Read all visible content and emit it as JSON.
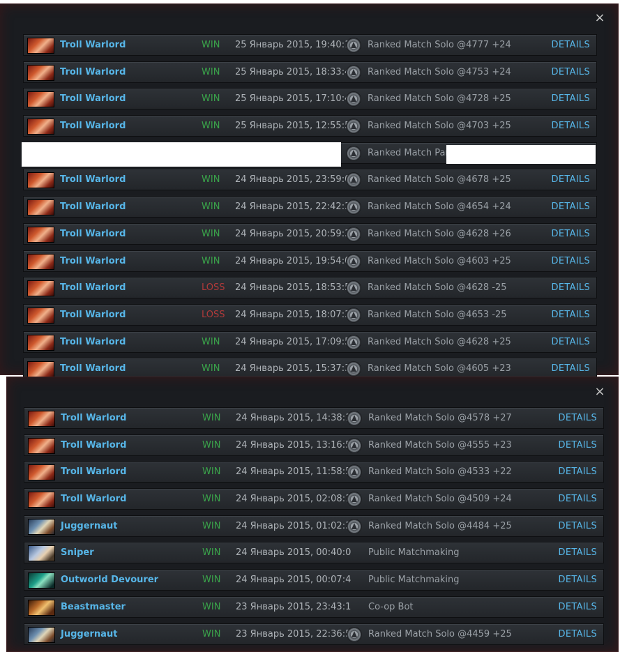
{
  "close_glyph": "×",
  "details_label": "DETAILS",
  "panel1": {
    "matches": [
      {
        "hero": "Troll Warlord",
        "hero_icon": "troll-warlord-portrait",
        "result": "WIN",
        "date": "25 Январь 2015, 19:40:1",
        "mode": "Ranked Match Solo @4777 +24",
        "mm_icon": true
      },
      {
        "hero": "Troll Warlord",
        "hero_icon": "troll-warlord-portrait",
        "result": "WIN",
        "date": "25 Январь 2015, 18:33:4",
        "mode": "Ranked Match Solo @4753 +24",
        "mm_icon": true
      },
      {
        "hero": "Troll Warlord",
        "hero_icon": "troll-warlord-portrait",
        "result": "WIN",
        "date": "25 Январь 2015, 17:10:4",
        "mode": "Ranked Match Solo @4728 +25",
        "mm_icon": true
      },
      {
        "hero": "Troll Warlord",
        "hero_icon": "troll-warlord-portrait",
        "result": "WIN",
        "date": "25 Январь 2015, 12:55:5",
        "mode": "Ranked Match Solo @4703 +25",
        "mm_icon": true
      },
      {
        "hero": "",
        "hero_icon": "",
        "result": "",
        "date": "",
        "mode": "Ranked Match Party",
        "mm_icon": true,
        "redacted": true
      },
      {
        "hero": "Troll Warlord",
        "hero_icon": "troll-warlord-portrait",
        "result": "WIN",
        "date": "24 Январь 2015, 23:59:0",
        "mode": "Ranked Match Solo @4678 +25",
        "mm_icon": true
      },
      {
        "hero": "Troll Warlord",
        "hero_icon": "troll-warlord-portrait",
        "result": "WIN",
        "date": "24 Январь 2015, 22:42:3",
        "mode": "Ranked Match Solo @4654 +24",
        "mm_icon": true
      },
      {
        "hero": "Troll Warlord",
        "hero_icon": "troll-warlord-portrait",
        "result": "WIN",
        "date": "24 Январь 2015, 20:59:3",
        "mode": "Ranked Match Solo @4628 +26",
        "mm_icon": true
      },
      {
        "hero": "Troll Warlord",
        "hero_icon": "troll-warlord-portrait",
        "result": "WIN",
        "date": "24 Январь 2015, 19:54:0",
        "mode": "Ranked Match Solo @4603 +25",
        "mm_icon": true
      },
      {
        "hero": "Troll Warlord",
        "hero_icon": "troll-warlord-portrait",
        "result": "LOSS",
        "date": "24 Январь 2015, 18:53:5",
        "mode": "Ranked Match Solo @4628 -25",
        "mm_icon": true
      },
      {
        "hero": "Troll Warlord",
        "hero_icon": "troll-warlord-portrait",
        "result": "LOSS",
        "date": "24 Январь 2015, 18:07:3",
        "mode": "Ranked Match Solo @4653 -25",
        "mm_icon": true
      },
      {
        "hero": "Troll Warlord",
        "hero_icon": "troll-warlord-portrait",
        "result": "WIN",
        "date": "24 Январь 2015, 17:09:5",
        "mode": "Ranked Match Solo @4628 +25",
        "mm_icon": true
      },
      {
        "hero": "Troll Warlord",
        "hero_icon": "troll-warlord-portrait",
        "result": "WIN",
        "date": "24 Январь 2015, 15:37:3",
        "mode": "Ranked Match Solo @4605 +23",
        "mm_icon": true
      }
    ]
  },
  "panel2": {
    "matches": [
      {
        "hero": "Troll Warlord",
        "hero_icon": "troll-warlord-portrait",
        "result": "WIN",
        "date": "24 Январь 2015, 14:38:1",
        "mode": "Ranked Match Solo @4578 +27",
        "mm_icon": true
      },
      {
        "hero": "Troll Warlord",
        "hero_icon": "troll-warlord-portrait",
        "result": "WIN",
        "date": "24 Январь 2015, 13:16:5",
        "mode": "Ranked Match Solo @4555 +23",
        "mm_icon": true
      },
      {
        "hero": "Troll Warlord",
        "hero_icon": "troll-warlord-portrait",
        "result": "WIN",
        "date": "24 Январь 2015, 11:58:5",
        "mode": "Ranked Match Solo @4533 +22",
        "mm_icon": true
      },
      {
        "hero": "Troll Warlord",
        "hero_icon": "troll-warlord-portrait",
        "result": "WIN",
        "date": "24 Январь 2015, 02:08:1",
        "mode": "Ranked Match Solo @4509 +24",
        "mm_icon": true
      },
      {
        "hero": "Juggernaut",
        "hero_icon": "juggernaut-portrait",
        "result": "WIN",
        "date": "24 Январь 2015, 01:02:3",
        "mode": "Ranked Match Solo @4484 +25",
        "mm_icon": true
      },
      {
        "hero": "Sniper",
        "hero_icon": "sniper-portrait",
        "result": "WIN",
        "date": "24 Январь 2015, 00:40:0",
        "mode": "Public Matchmaking",
        "mm_icon": false
      },
      {
        "hero": "Outworld Devourer",
        "hero_icon": "outworld-devourer-portrait",
        "result": "WIN",
        "date": "24 Январь 2015, 00:07:4",
        "mode": "Public Matchmaking",
        "mm_icon": false
      },
      {
        "hero": "Beastmaster",
        "hero_icon": "beastmaster-portrait",
        "result": "WIN",
        "date": "23 Январь 2015, 23:43:1",
        "mode": "Co-op Bot",
        "mm_icon": false
      },
      {
        "hero": "Juggernaut",
        "hero_icon": "juggernaut-portrait",
        "result": "WIN",
        "date": "23 Январь 2015, 22:36:5",
        "mode": "Ranked Match Solo @4459 +25",
        "mm_icon": true
      }
    ]
  },
  "colors": {
    "hero_name": "#57b6e8",
    "win": "#3aa34a",
    "loss": "#b13a3a",
    "details": "#57b6e8",
    "row_bg": "#2a2d32",
    "panel_bg": "#1a1c20"
  }
}
